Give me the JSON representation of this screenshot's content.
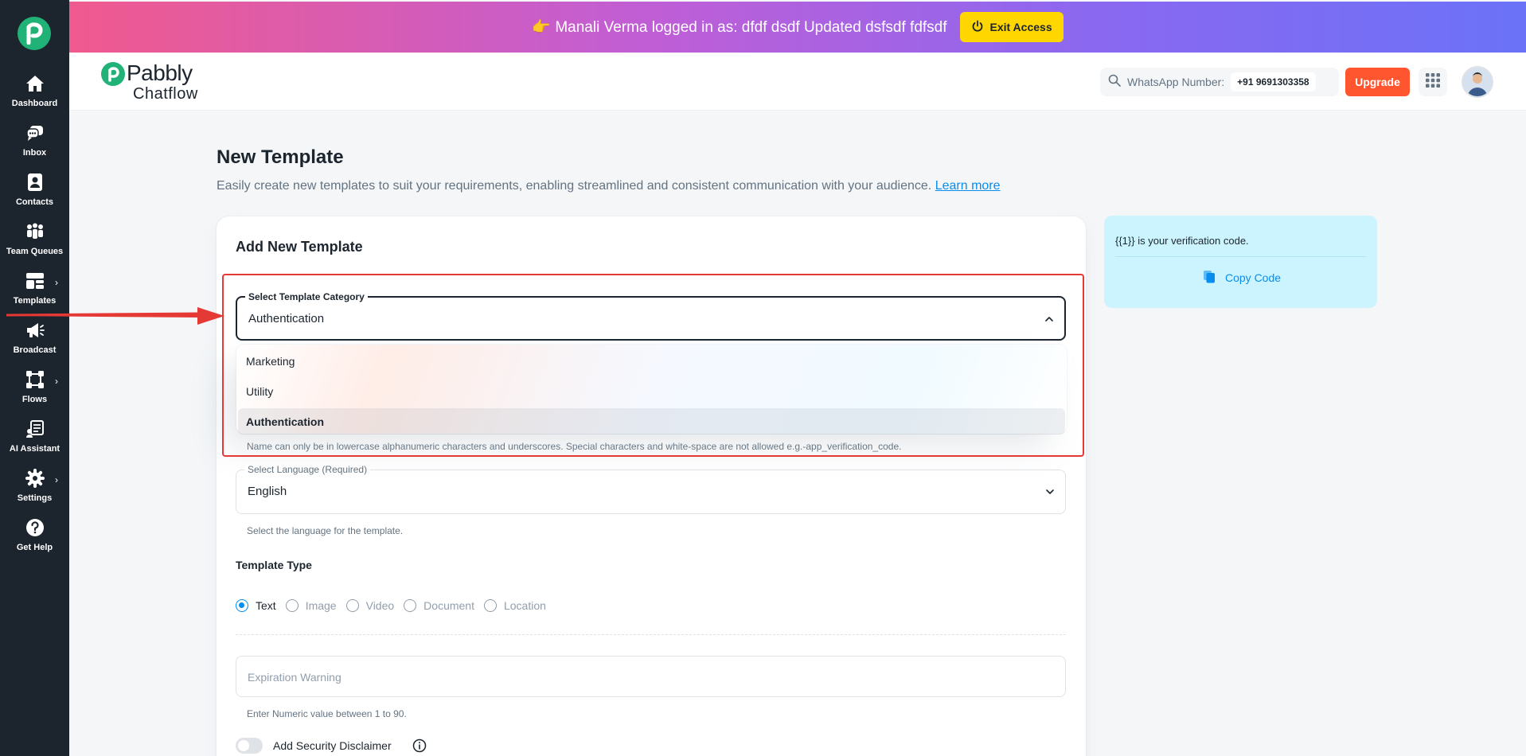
{
  "sidebar": {
    "items": [
      {
        "label": "Dashboard",
        "icon": "home-icon"
      },
      {
        "label": "Inbox",
        "icon": "chat-icon"
      },
      {
        "label": "Contacts",
        "icon": "contacts-icon"
      },
      {
        "label": "Team Queues",
        "icon": "team-icon"
      },
      {
        "label": "Templates",
        "icon": "templates-icon"
      },
      {
        "label": "Broadcast",
        "icon": "megaphone-icon"
      },
      {
        "label": "Flows",
        "icon": "flows-icon"
      },
      {
        "label": "AI Assistant",
        "icon": "ai-assistant-icon"
      },
      {
        "label": "Settings",
        "icon": "gear-icon"
      },
      {
        "label": "Get Help",
        "icon": "help-icon"
      }
    ]
  },
  "banner": {
    "text": "👉 Manali Verma logged in as: dfdf dsdf Updated dsfsdf fdfsdf",
    "exit_label": "Exit Access"
  },
  "header": {
    "brand_name": "Pabbly",
    "brand_sub": "Chatflow",
    "whatsapp_label": "WhatsApp Number:",
    "whatsapp_number": "+91 9691303358",
    "upgrade_label": "Upgrade"
  },
  "page": {
    "title": "New Template",
    "description": "Easily create new templates to suit your requirements, enabling streamlined and consistent communication with your audience.",
    "learn_more": "Learn more"
  },
  "form": {
    "card_title": "Add New Template",
    "category": {
      "label": "Select Template Category",
      "value": "Authentication",
      "options": [
        "Marketing",
        "Utility",
        "Authentication"
      ]
    },
    "name_helper": "Name can only be in lowercase alphanumeric characters and underscores. Special characters and white-space are not allowed e.g.-app_verification_code.",
    "language": {
      "label": "Select Language (Required)",
      "value": "English",
      "helper": "Select the language for the template."
    },
    "template_type": {
      "label": "Template Type",
      "options": [
        "Text",
        "Image",
        "Video",
        "Document",
        "Location"
      ],
      "selected": "Text"
    },
    "expiration": {
      "placeholder": "Expiration Warning",
      "helper": "Enter Numeric value between 1 to 90."
    },
    "security_disclaimer_label": "Add Security Disclaimer"
  },
  "preview": {
    "message": "{{1}} is your verification code.",
    "copy_label": "Copy Code"
  },
  "colors": {
    "sidebar": "#1c252e",
    "brand_green": "#20b276",
    "accent_blue": "#078dee",
    "upgrade": "#ff5630",
    "exit_button": "#ffd600",
    "preview_bg": "#ccf4fe",
    "annotation_red": "#e53935"
  }
}
